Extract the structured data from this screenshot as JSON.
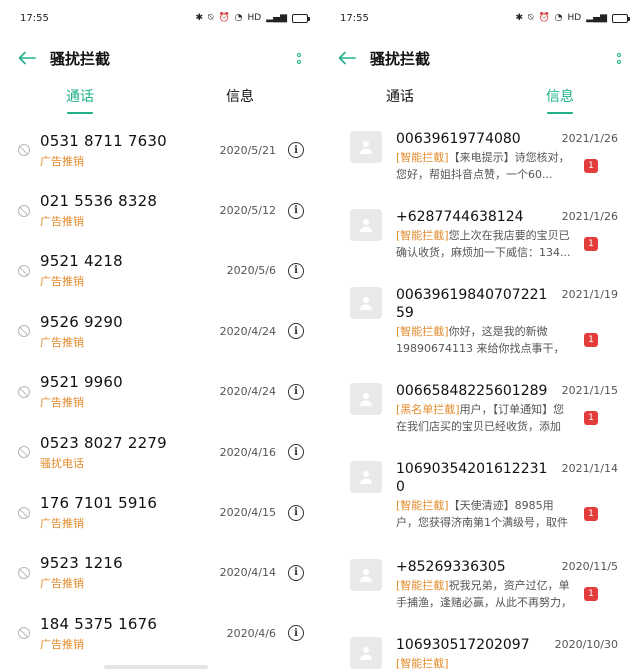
{
  "status_bar": {
    "time": "17:55",
    "network": "HD"
  },
  "header": {
    "title": "骚扰拦截"
  },
  "tabs": {
    "calls": "通话",
    "messages": "信息"
  },
  "calls": [
    {
      "number": "0531 8711 7630",
      "tag": "广告推销",
      "date": "2020/5/21"
    },
    {
      "number": "021 5536 8328",
      "tag": "广告推销",
      "date": "2020/5/12"
    },
    {
      "number": "9521 4218",
      "tag": "广告推销",
      "date": "2020/5/6"
    },
    {
      "number": "9526 9290",
      "tag": "广告推销",
      "date": "2020/4/24"
    },
    {
      "number": "9521 9960",
      "tag": "广告推销",
      "date": "2020/4/24"
    },
    {
      "number": "0523 8027 2279",
      "tag": "骚扰电话",
      "date": "2020/4/16"
    },
    {
      "number": "176 7101 5916",
      "tag": "广告推销",
      "date": "2020/4/15"
    },
    {
      "number": "9523 1216",
      "tag": "广告推销",
      "date": "2020/4/14"
    },
    {
      "number": "184 5375 1676",
      "tag": "广告推销",
      "date": "2020/4/6"
    }
  ],
  "messages": [
    {
      "number": "00639619774080",
      "date": "2021/1/26",
      "tag": "[智能拦截]",
      "text": "【来电提示】诗您核对，您好，帮姐抖音点赞，一个60...",
      "badge": "1"
    },
    {
      "number": "+6287744638124",
      "date": "2021/1/26",
      "tag": "[智能拦截]",
      "text": "您上次在我店要的宝贝已确认收货，麻烦加一下威信：134...",
      "badge": "1"
    },
    {
      "number": "0063961984070722159",
      "date": "2021/1/19",
      "tag": "[智能拦截]",
      "text": "你好，这是我的新微19890674113 来给你找点事干，给...",
      "badge": "1"
    },
    {
      "number": "00665848225601289",
      "date": "2021/1/15",
      "tag": "[黑名单拦截]",
      "text": "用户，【订单通知】您在我们店买的宝贝已经收货，添加微...",
      "badge": "1"
    },
    {
      "number": "106903542016122310",
      "date": "2021/1/14",
      "tag": "[智能拦截]",
      "text": "【天使清迹】8985用户，您获得济南第1个满级号，取件码：...",
      "badge": "1"
    },
    {
      "number": "+85269336305",
      "date": "2020/11/5",
      "tag": "[智能拦截]",
      "text": "祝我兄弟，资产过亿，单手捕渔，逢赌必赢，从此不再努力，点...",
      "badge": "1"
    },
    {
      "number": "106930517202097",
      "date": "2020/10/30",
      "tag": "[智能拦截]",
      "text": "",
      "badge": ""
    }
  ]
}
